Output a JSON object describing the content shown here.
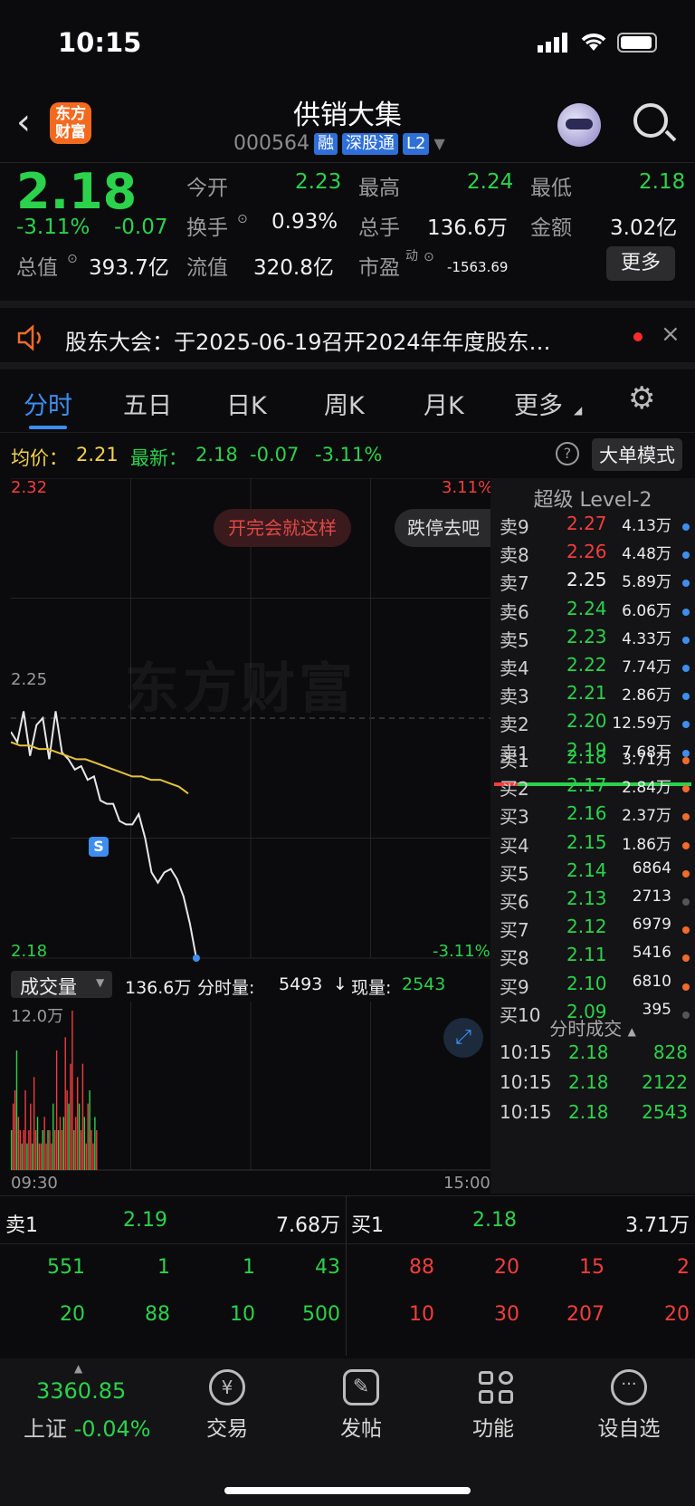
{
  "status": {
    "time": "10:15"
  },
  "nav": {
    "logo": "东方\n财富",
    "title": "供销大集",
    "code": "000564",
    "tags": [
      "融",
      "深股通",
      "L2"
    ]
  },
  "quote": {
    "price": "2.18",
    "pct": "-3.11%",
    "chg": "-0.07",
    "open_label": "今开",
    "open": "2.23",
    "high_label": "最高",
    "high": "2.24",
    "low_label": "最低",
    "low": "2.18",
    "turnover_label": "换手",
    "turnover": "0.93%",
    "volume_label": "总手",
    "volume": "136.6万",
    "amount_label": "金额",
    "amount": "3.02亿",
    "mktcap_label": "总值",
    "mktcap": "393.7亿",
    "float_label": "流值",
    "float": "320.8亿",
    "pe_label": "市盈",
    "pe_sup": "动",
    "pe": "-1563.69",
    "more": "更多"
  },
  "notice": {
    "text": "股东大会：于2025-06-19召开2024年年度股东…"
  },
  "tabs": [
    "分时",
    "五日",
    "日K",
    "周K",
    "月K",
    "更多"
  ],
  "avg": {
    "avg_label": "均价：",
    "avg": "2.21",
    "latest_label": "最新：",
    "latest": "2.18",
    "chg": "-0.07",
    "pct": "-3.11%",
    "mode": "大单模式"
  },
  "chart": {
    "y_top": "2.32",
    "y_mid": "2.25",
    "y_bot": "2.18",
    "pct_top": "3.11%",
    "pct_bot": "-3.11%",
    "chip1": "开完会就这样",
    "chip2": "跌停去吧",
    "watermark": "东方财富",
    "marker": "S"
  },
  "chart_data": {
    "type": "line",
    "series": [
      {
        "name": "",
        "values": [
          2.246,
          2.243,
          2.252,
          2.239,
          2.248,
          2.25,
          2.238,
          2.252,
          2.24,
          2.238,
          2.235,
          2.236,
          2.232,
          2.233,
          2.226,
          2.225,
          2.225,
          2.22,
          2.219,
          2.219,
          2.222,
          2.215,
          2.205,
          2.202,
          2.205,
          2.206,
          2.203,
          2.198,
          2.19,
          2.18
        ]
      },
      {
        "name": "均价",
        "values": [
          2.243,
          2.242,
          2.242,
          2.241,
          2.241,
          2.24,
          2.239,
          2.238,
          2.238,
          2.237,
          2.236,
          2.235,
          2.234,
          2.233,
          2.233,
          2.232,
          2.232,
          2.231,
          2.23,
          2.228
        ]
      }
    ],
    "ylim": [
      2.18,
      2.32
    ],
    "xlabels": [
      "09:30",
      "15:00"
    ]
  },
  "volume_bar": {
    "label": "成交量",
    "total": "136.6万",
    "seg_label": "分时量:",
    "seg": "5493",
    "arrow": "↓",
    "now_label": "现量:",
    "now": "2543",
    "ymax": "12.0万"
  },
  "volume_data": [
    3,
    5,
    6,
    9,
    4,
    3,
    2,
    3,
    6,
    2,
    3,
    5,
    2,
    7,
    3,
    4,
    2,
    2,
    3,
    4,
    2,
    3,
    3,
    2,
    5,
    3,
    9,
    3,
    4,
    3,
    4,
    10,
    6,
    5,
    8,
    12,
    3,
    4,
    7,
    5,
    3,
    8,
    4,
    2,
    5,
    6,
    3,
    2,
    4,
    3
  ],
  "orderbook": {
    "header": "超级 Level-2",
    "asks": [
      {
        "label": "卖9",
        "price": "2.27",
        "vol": "4.13万",
        "color": "red",
        "dot": "#3e8ef2"
      },
      {
        "label": "卖8",
        "price": "2.26",
        "vol": "4.48万",
        "color": "red",
        "dot": "#3e8ef2"
      },
      {
        "label": "卖7",
        "price": "2.25",
        "vol": "5.89万",
        "color": "white",
        "dot": "#3e8ef2"
      },
      {
        "label": "卖6",
        "price": "2.24",
        "vol": "6.06万",
        "color": "green",
        "dot": "#3e8ef2"
      },
      {
        "label": "卖5",
        "price": "2.23",
        "vol": "4.33万",
        "color": "green",
        "dot": "#3e8ef2"
      },
      {
        "label": "卖4",
        "price": "2.22",
        "vol": "7.74万",
        "color": "green",
        "dot": "#3e8ef2"
      },
      {
        "label": "卖3",
        "price": "2.21",
        "vol": "2.86万",
        "color": "green",
        "dot": "#3e8ef2"
      },
      {
        "label": "卖2",
        "price": "2.20",
        "vol": "12.59万",
        "color": "green",
        "dot": "#3e8ef2"
      },
      {
        "label": "卖1",
        "price": "2.19",
        "vol": "7.68万",
        "color": "green",
        "dot": "#3e8ef2"
      }
    ],
    "bids": [
      {
        "label": "买1",
        "price": "2.18",
        "vol": "3.71万",
        "color": "green",
        "dot": "#f26b2a"
      },
      {
        "label": "买2",
        "price": "2.17",
        "vol": "2.84万",
        "color": "green",
        "dot": "#f26b2a"
      },
      {
        "label": "买3",
        "price": "2.16",
        "vol": "2.37万",
        "color": "green",
        "dot": "#f26b2a"
      },
      {
        "label": "买4",
        "price": "2.15",
        "vol": "1.86万",
        "color": "green",
        "dot": "#f26b2a"
      },
      {
        "label": "买5",
        "price": "2.14",
        "vol": "6864",
        "color": "green",
        "dot": "#f26b2a"
      },
      {
        "label": "买6",
        "price": "2.13",
        "vol": "2713",
        "color": "green",
        "dot": "#555"
      },
      {
        "label": "买7",
        "price": "2.12",
        "vol": "6979",
        "color": "green",
        "dot": "#f26b2a"
      },
      {
        "label": "买8",
        "price": "2.11",
        "vol": "5416",
        "color": "green",
        "dot": "#f26b2a"
      },
      {
        "label": "买9",
        "price": "2.10",
        "vol": "6810",
        "color": "green",
        "dot": "#f26b2a"
      },
      {
        "label": "买10",
        "price": "2.09",
        "vol": "395",
        "color": "green",
        "dot": "#555"
      }
    ],
    "trades_header": "分时成交",
    "trades": [
      {
        "time": "10:15",
        "price": "2.18",
        "vol": "828"
      },
      {
        "time": "10:15",
        "price": "2.18",
        "vol": "2122"
      },
      {
        "time": "10:15",
        "price": "2.18",
        "vol": "2543"
      }
    ]
  },
  "bottom": {
    "ask1_label": "卖1",
    "ask1_price": "2.19",
    "ask1_vol": "7.68万",
    "bid1_label": "买1",
    "bid1_price": "2.18",
    "bid1_vol": "3.71万",
    "ask_queue": [
      "551",
      "1",
      "1",
      "43",
      "20",
      "88",
      "10",
      "500"
    ],
    "bid_queue": [
      "88",
      "20",
      "15",
      "2",
      "10",
      "30",
      "207",
      "20"
    ]
  },
  "dock": {
    "index_value": "3360.85",
    "index_name": "上证",
    "index_pct": "-0.04%",
    "items": [
      "交易",
      "发帖",
      "功能",
      "设自选"
    ]
  }
}
